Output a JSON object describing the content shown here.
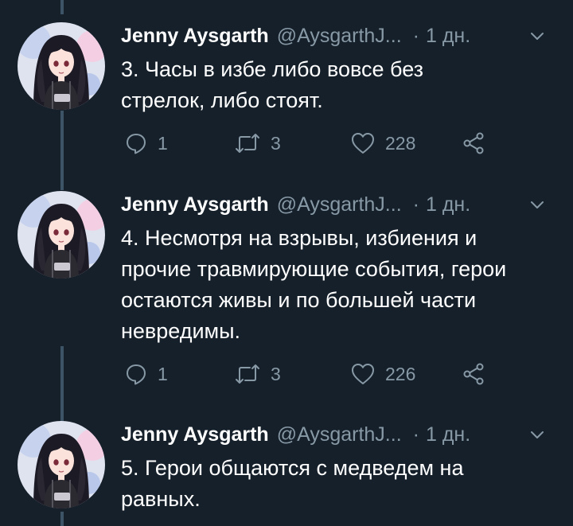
{
  "tweets": [
    {
      "name": "Jenny Aysgarth",
      "handle": "@AysgarthJ...",
      "dot": "·",
      "time": "1 дн.",
      "text": "3. Часы в избе либо вовсе без\nстрелок, либо стоят.",
      "replies": "1",
      "retweets": "3",
      "likes": "228"
    },
    {
      "name": "Jenny Aysgarth",
      "handle": "@AysgarthJ...",
      "dot": "·",
      "time": "1 дн.",
      "text": "4. Несмотря на взрывы, избиения и\nпрочие травмирующие события, герои\nостаются живы и по большей части\nневредимы.",
      "replies": "1",
      "retweets": "3",
      "likes": "226"
    },
    {
      "name": "Jenny Aysgarth",
      "handle": "@AysgarthJ...",
      "dot": "·",
      "time": "1 дн.",
      "text": "5. Герои общаются с медведем на\nравных."
    }
  ],
  "colors": {
    "background": "#15202b",
    "text": "#ffffff",
    "secondary": "#8899a6",
    "thread_line": "#3d5466"
  },
  "icons": {
    "reply": "speech-bubble-icon",
    "retweet": "retweet-arrows-icon",
    "like": "heart-icon",
    "share": "share-icon",
    "menu": "chevron-down-icon"
  }
}
